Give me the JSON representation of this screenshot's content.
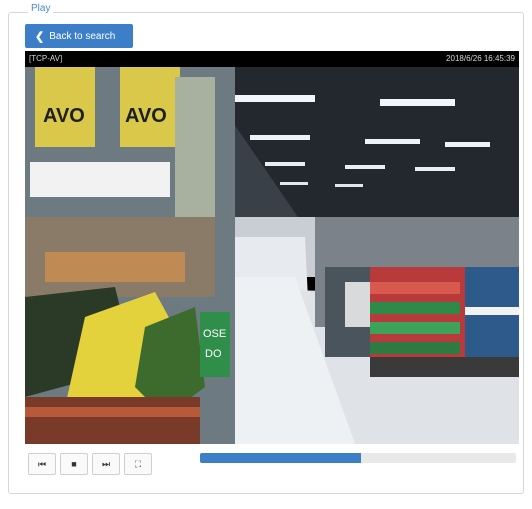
{
  "section": {
    "legend": "Play"
  },
  "back_button": {
    "label": "Back to search"
  },
  "video": {
    "source_label": "[TCP-AV]",
    "timestamp": "2018/6/26 16:45:39"
  },
  "controls": {
    "rewind_icon": "⏮",
    "stop_icon": "■",
    "forward_icon": "⏭",
    "fullscreen_icon": "⛶"
  },
  "progress": {
    "value": 0.51
  },
  "colors": {
    "accent": "#3d7ec9",
    "legend": "#4a8ad0"
  }
}
